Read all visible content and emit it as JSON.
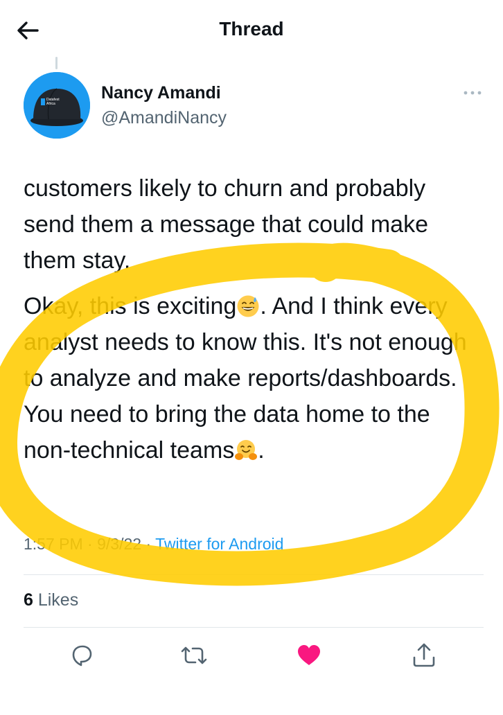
{
  "header": {
    "title": "Thread",
    "back_icon": "arrow-left-icon"
  },
  "author": {
    "name": "Nancy Amandi",
    "handle": "@AmandiNancy",
    "avatar_cap_text": "Datafest Africa"
  },
  "tweet": {
    "paragraph1": "customers likely to churn and probably send them a message that could make them stay.",
    "paragraph2_before_emoji": "Okay, this is exciting",
    "paragraph2_emoji": "grinning-face-with-sweat-emoji",
    "paragraph2_after_emoji": ". And I think every analyst needs to know this. It's not enough to analyze and make reports/dashboards. You need to bring the data home to the non-technical teams",
    "paragraph2_end_emoji": "hugging-face-emoji",
    "paragraph2_end": "."
  },
  "meta": {
    "time": "1:57 PM",
    "sep1": " · ",
    "date": "9/3/22",
    "sep2": " · ",
    "source": "Twitter for Android"
  },
  "stats": {
    "likes_count": "6",
    "likes_label": " Likes"
  },
  "actions": {
    "reply_icon": "reply-icon",
    "retweet_icon": "retweet-icon",
    "like_icon": "heart-icon",
    "share_icon": "share-icon",
    "liked": true
  },
  "colors": {
    "accent": "#1d9bf0",
    "like": "#f91880",
    "highlight": "#ffcc00",
    "text": "#0f1419",
    "muted": "#536471"
  }
}
